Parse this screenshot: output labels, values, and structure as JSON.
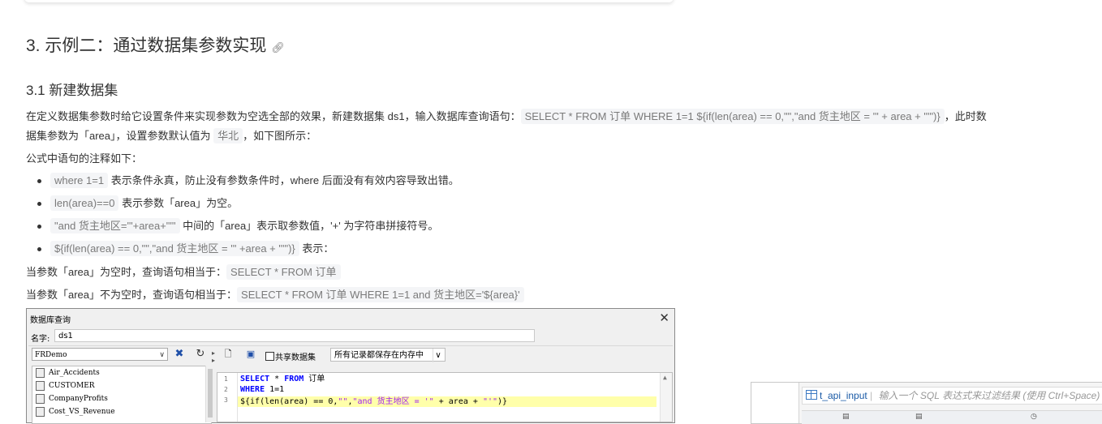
{
  "heading": {
    "title": "3. 示例二：通过数据集参数实现",
    "anchor_icon": "link-icon"
  },
  "subheading": "3.1 新建数据集",
  "intro": {
    "text1": "在定义数据集参数时给它设置条件来实现参数为空选全部的效果，新建数据集 ds1，输入数据库查询语句：",
    "code1": "SELECT * FROM 订单  WHERE 1=1  ${if(len(area) == 0,\"\",\"and 货主地区 = '\" + area + \"'\")}",
    "text2": "，此时数",
    "text3": "据集参数为「area」，设置参数默认值为",
    "code2": "华北",
    "text4": "，如下图所示："
  },
  "note_line": "公式中语句的注释如下：",
  "bullets": [
    {
      "code": "where 1=1",
      "text": "表示条件永真，防止没有参数条件时，where 后面没有有效内容导致出错。"
    },
    {
      "code": "len(area)==0",
      "text": "表示参数「area」为空。"
    },
    {
      "code": "\"and 货主地区='\"+area+\"'\"",
      "text": "中间的「area」表示取参数值，'+' 为字符串拼接符号。"
    },
    {
      "code": "${if(len(area) == 0,\"\",\"and 货主地区 = '\" +area + \"'\")}",
      "text": "表示："
    }
  ],
  "case_empty": {
    "text": "当参数「area」为空时，查询语句相当于：",
    "code": "SELECT * FROM 订单"
  },
  "case_nonempty": {
    "text": "当参数「area」不为空时，查询语句相当于：",
    "code": "SELECT * FROM 订单 WHERE 1=1 and 货主地区='${area}'"
  },
  "dialog": {
    "title": "数据库查询",
    "close_icon": "close-icon",
    "name_label": "名字:",
    "name_value": "ds1",
    "datasource": "FRDemo",
    "tables": [
      "Air_Accidents",
      "CUSTOMER",
      "CompanyProfits",
      "Cost_VS_Revenue"
    ],
    "share_label": "共享数据集",
    "share_checked": false,
    "mode": "所有记录都保存在内存中",
    "editor": {
      "line_numbers": [
        "1",
        "2",
        "3"
      ],
      "line1": {
        "kw1": "SELECT",
        "op": " * ",
        "kw2": "FROM",
        "rest": " 订单"
      },
      "line2": {
        "kw": "WHERE",
        "rest": " 1=1"
      },
      "line3": {
        "p1": "${if(len(area) == 0,",
        "s1": "\"\"",
        "p2": ",",
        "s2": "\"and 货主地区 = '\"",
        "p3": " + area + ",
        "s3": "\"'\"",
        "p4": ")}"
      }
    }
  },
  "side_panel": {
    "table_name": "t_api_input",
    "hint": "输入一个 SQL 表达式来过滤结果 (使用 Ctrl+Space)"
  }
}
